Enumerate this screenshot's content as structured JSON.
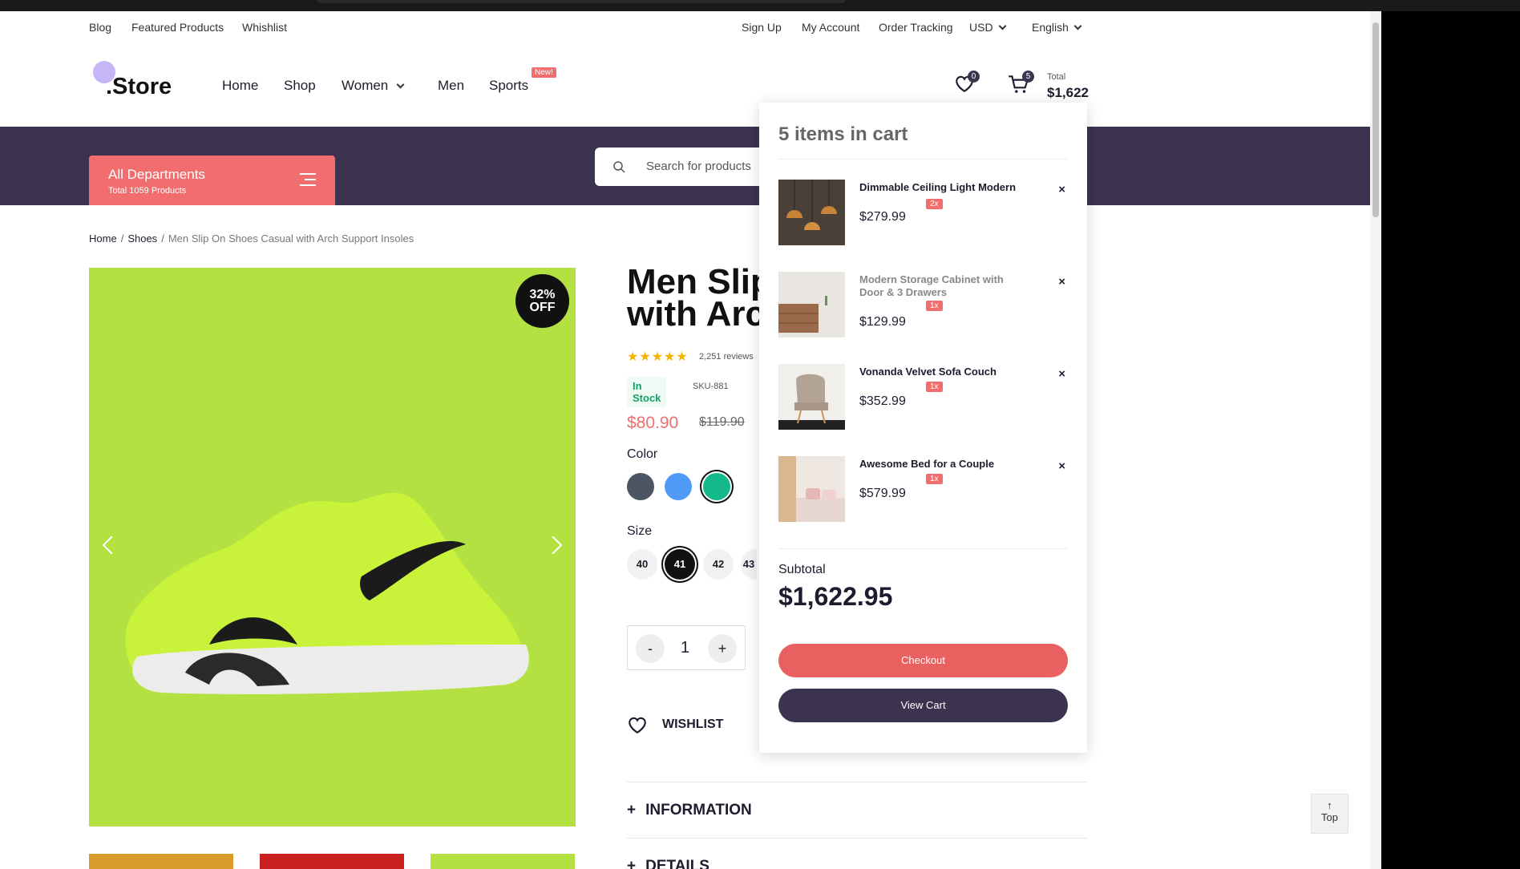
{
  "utility": {
    "left": [
      "Blog",
      "Featured Products",
      "Whishlist"
    ],
    "right": [
      "Sign Up",
      "My Account",
      "Order Tracking"
    ],
    "currency": "USD",
    "language": "English"
  },
  "header": {
    "logo": ".Store",
    "nav": [
      "Home",
      "Shop",
      "Women",
      "Men",
      "Sports"
    ],
    "sports_badge": "New!",
    "wishlist_count": "0",
    "cart_count": "5",
    "total_label": "Total",
    "total_value": "$1,622"
  },
  "departments": {
    "title": "All Departments",
    "subtitle": "Total 1059 Products"
  },
  "search": {
    "placeholder": "Search for products"
  },
  "breadcrumb": {
    "home": "Home",
    "category": "Shoes",
    "current": "Men Slip On Shoes Casual with Arch Support Insoles"
  },
  "product": {
    "discount_line1": "32%",
    "discount_line2": "OFF",
    "title_line1": "Men Slip",
    "title_line2": "with Arc",
    "reviews": "2,251 reviews",
    "rating": 5,
    "stock": "In Stock",
    "sku": "SKU-881",
    "price": "$80.90",
    "old_price": "$119.90",
    "color_label": "Color",
    "colors": [
      "#4b5563",
      "#4f9af7",
      "#14b88a"
    ],
    "size_label": "Size",
    "sizes": [
      "40",
      "41",
      "42",
      "43"
    ],
    "quantity": "1",
    "minus": "-",
    "plus": "+",
    "wishlist": "WISHLIST",
    "accordion": [
      "INFORMATION",
      "DETAILS"
    ],
    "accent_color": "#f26d6d"
  },
  "cart": {
    "heading": "5 items in cart",
    "items": [
      {
        "name": "Dimmable Ceiling Light Modern",
        "qty": "2x",
        "price": "$279.99"
      },
      {
        "name": "Modern Storage Cabinet with Door & 3 Drawers",
        "qty": "1x",
        "price": "$129.99"
      },
      {
        "name": "Vonanda Velvet Sofa Couch",
        "qty": "1x",
        "price": "$352.99"
      },
      {
        "name": "Awesome Bed for a Couple",
        "qty": "1x",
        "price": "$579.99"
      }
    ],
    "remove": "×",
    "subtotal_label": "Subtotal",
    "subtotal_value": "$1,622.95",
    "checkout": "Checkout",
    "view_cart": "View Cart"
  },
  "to_top": "Top"
}
